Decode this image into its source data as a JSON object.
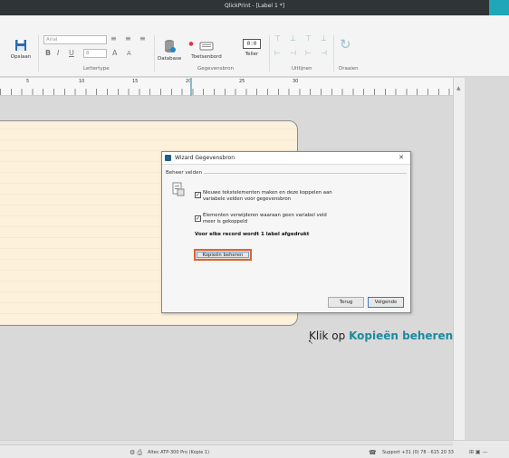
{
  "window": {
    "title": "QlickPrint - [Label 1 *]",
    "accent_color": "#1fa7b7"
  },
  "ribbon": {
    "save_label": "Opslaan",
    "font_name": "Arial",
    "font_size": "8",
    "font_group_label": "Lettertype",
    "database_label": "Database",
    "keyboard_label": "Toetsenbord",
    "counter_label": "Teller",
    "counter_display": "0:0",
    "datasource_group_label": "Gegevensbron",
    "align_group_label": "Uitlijnen",
    "rotate_group_label": "Draaien"
  },
  "ruler": {
    "marks": [
      "5",
      "10",
      "15",
      "20",
      "25",
      "30"
    ]
  },
  "dialog": {
    "title": "Wizard Gegevensbron",
    "group_label": "Beheer velden",
    "option1": "Nieuwe tekstelementen maken en deze koppelen aan variabele velden voor gegevensbron",
    "option2": "Elementen verwijderen waaraan geen variabel veld meer is gekoppeld",
    "summary": "Voor elke record wordt 1 label afgedrukt",
    "copies_button": "Kopieën beheren",
    "back_button": "Terug",
    "next_button": "Volgende",
    "highlight_color": "#e0632a"
  },
  "callout": {
    "prefix": "Klik op ",
    "highlight": "Kopieën beheren"
  },
  "status": {
    "printer": "Altec ATP-300 Pro (Kopie 1)",
    "support": "Support +31 (0) 78 - 615 20 33"
  }
}
